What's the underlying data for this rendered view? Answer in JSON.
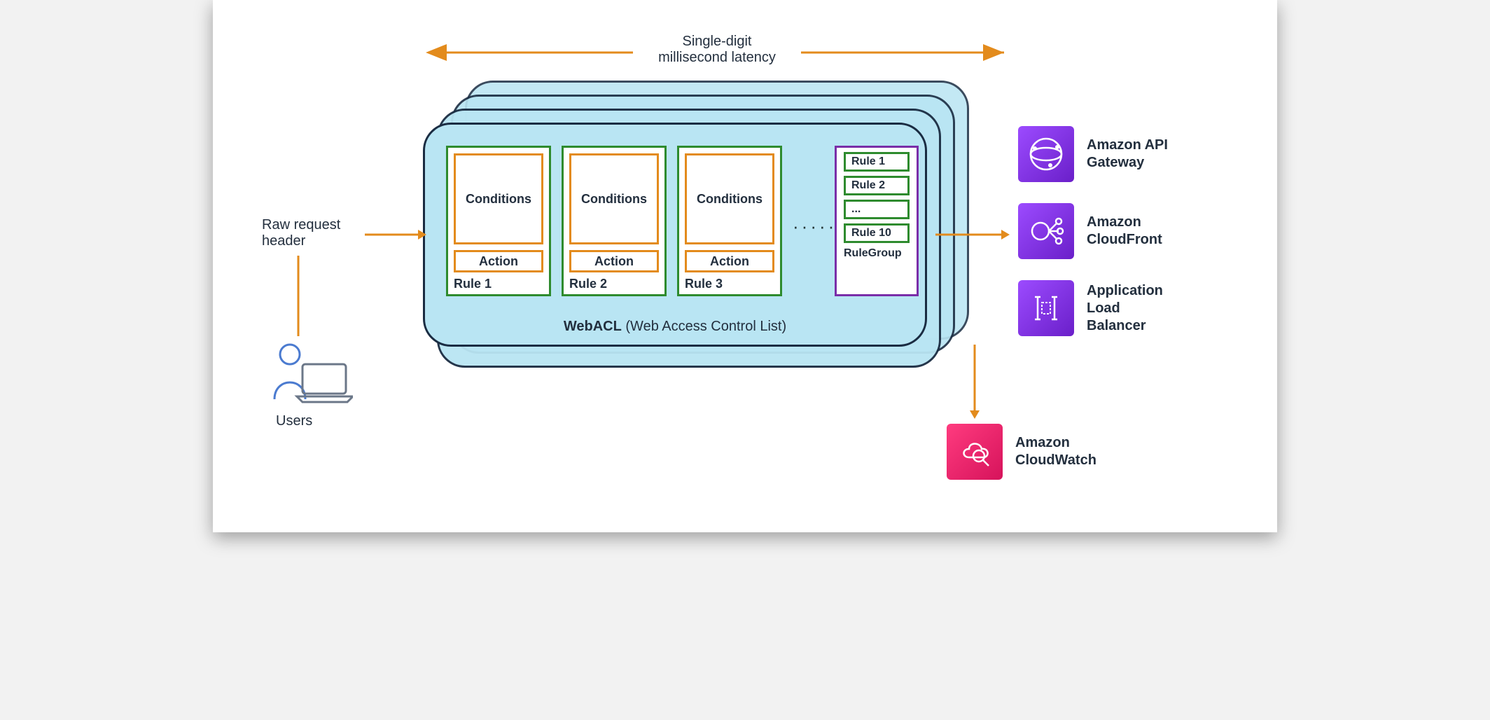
{
  "latency": {
    "line1": "Single-digit",
    "line2": "millisecond latency"
  },
  "left": {
    "raw1": "Raw request",
    "raw2": "header",
    "users": "Users"
  },
  "webacl": {
    "title_bold": "WebACL",
    "title_rest": " (Web Access Control List)"
  },
  "rules": {
    "cond": "Conditions",
    "act": "Action",
    "r1": "Rule 1",
    "r2": "Rule 2",
    "r3": "Rule 3",
    "dots": "······"
  },
  "rulegroup": {
    "items": [
      "Rule 1",
      "Rule 2",
      "...",
      "Rule 10"
    ],
    "label": "RuleGroup"
  },
  "services": {
    "api": {
      "l1": "Amazon API",
      "l2": "Gateway"
    },
    "cf": {
      "l1": "Amazon",
      "l2": "CloudFront"
    },
    "alb": {
      "l1": "Application",
      "l2": "Load",
      "l3": "Balancer"
    },
    "cw": {
      "l1": "Amazon",
      "l2": "CloudWatch"
    }
  },
  "colors": {
    "orange": "#e38b1c",
    "green": "#2e8b2e",
    "navy": "#1a2c42",
    "purple_a": "#9c4bff",
    "purple_b": "#6a1fc9",
    "magenta_a": "#ff3b7f",
    "magenta_b": "#d6135b",
    "blue_pale": "#b9e5f3"
  }
}
